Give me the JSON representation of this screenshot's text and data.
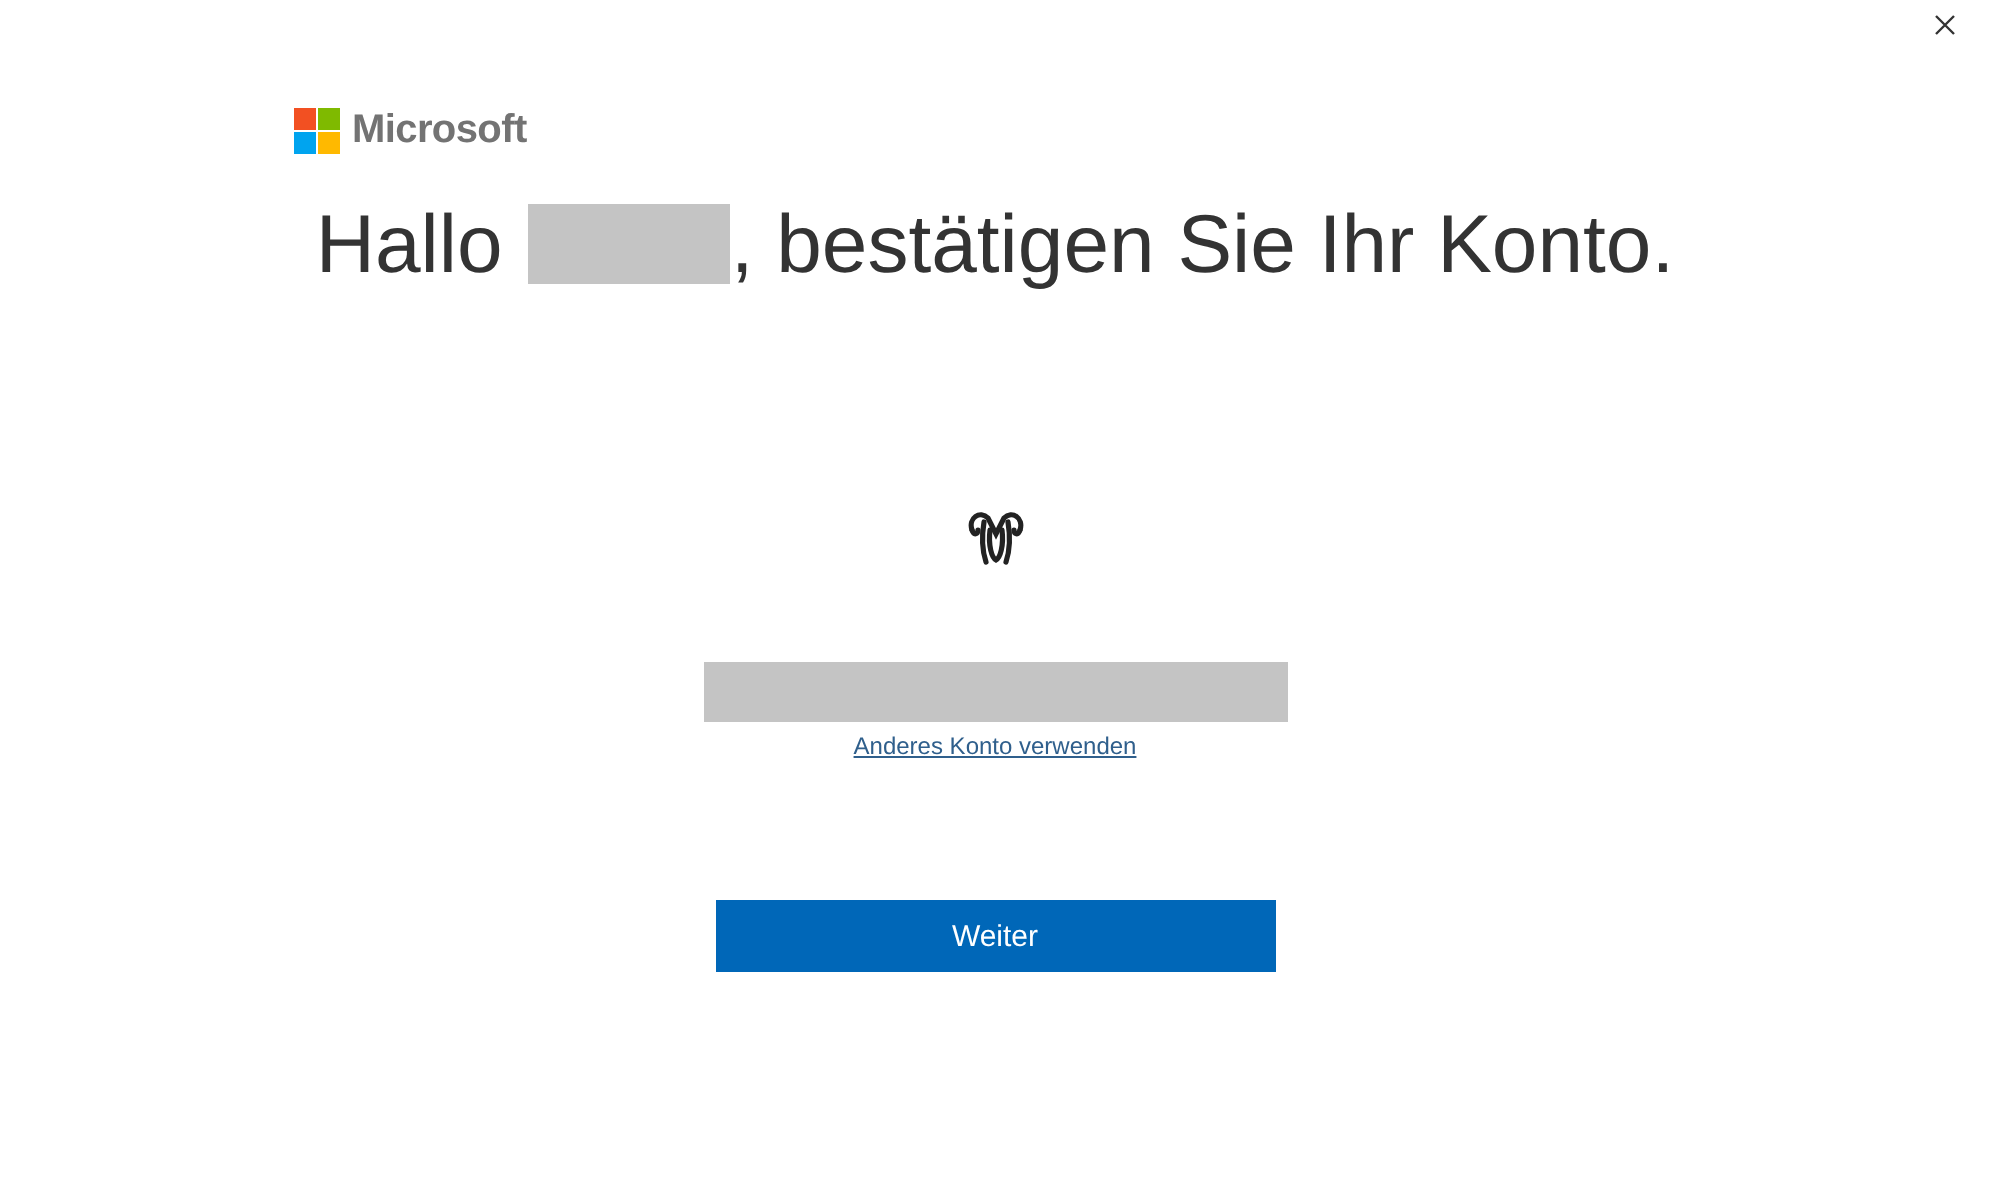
{
  "logo": {
    "text": "Microsoft"
  },
  "heading": {
    "greeting": "Hallo",
    "rest": ", bestätigen Sie Ihr Konto."
  },
  "link": "Anderes Konto verwenden",
  "button": "Weiter"
}
